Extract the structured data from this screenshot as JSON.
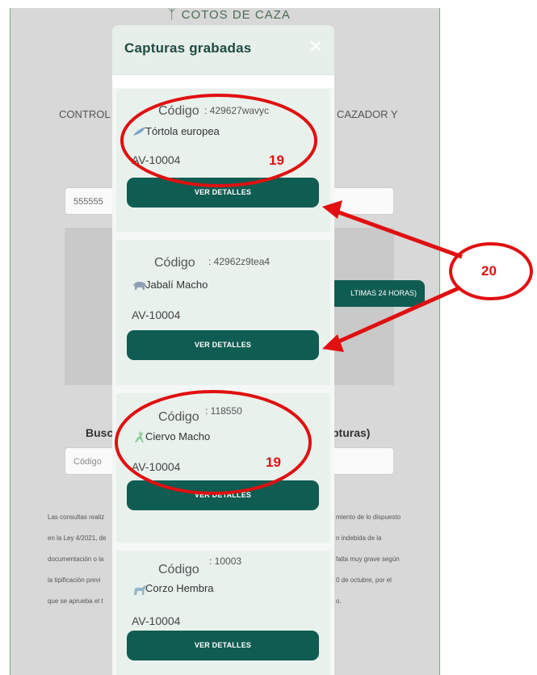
{
  "background": {
    "logo": "COTOS DE CAZA",
    "control_text": "CONTROL",
    "cazador_text": "CAZADOR Y",
    "input1_value": "555555",
    "btn_24h": "LTIMAS 24 HORAS)",
    "busc_text": "Busc",
    "capturas_text": "pturas)",
    "input2_placeholder": "Código",
    "legal_left": [
      "Las consultas realiz",
      "en la Ley 4/2021, de",
      "documentación o la",
      "la tipificación previ",
      "que se aprueba el t"
    ],
    "legal_right": [
      "miento de lo dispuesto",
      "n indebida de la",
      "falta muy grave según",
      "0 de octubre, por el",
      "o."
    ]
  },
  "modal": {
    "title": "Capturas grabadas",
    "close_icon": "close-icon",
    "cards": [
      {
        "code_label": "Código",
        "code_value": ": 429627wavyc",
        "species": "Tórtola europea",
        "species_icon": "bird-icon",
        "plate": "AV-10004",
        "button": "VER DETALLES"
      },
      {
        "code_label": "Código",
        "code_value": ": 42962z9tea4",
        "species": "Jabalí Macho",
        "species_icon": "boar-icon",
        "plate": "AV-10004",
        "button": "VER DETALLES"
      },
      {
        "code_label": "Código",
        "code_value": ": 118550",
        "species": "Ciervo Macho",
        "species_icon": "deer-icon",
        "plate": "AV-10004",
        "button": "VER DETALLES"
      },
      {
        "code_label": "Código",
        "code_value": ": 10003",
        "species": "Corzo Hembra",
        "species_icon": "roe-deer-icon",
        "plate": "AV-10004",
        "button": "VER DETALLES"
      }
    ]
  },
  "annotations": {
    "label_19_a": "19",
    "label_19_b": "19",
    "label_20": "20",
    "color": "#e01010"
  }
}
